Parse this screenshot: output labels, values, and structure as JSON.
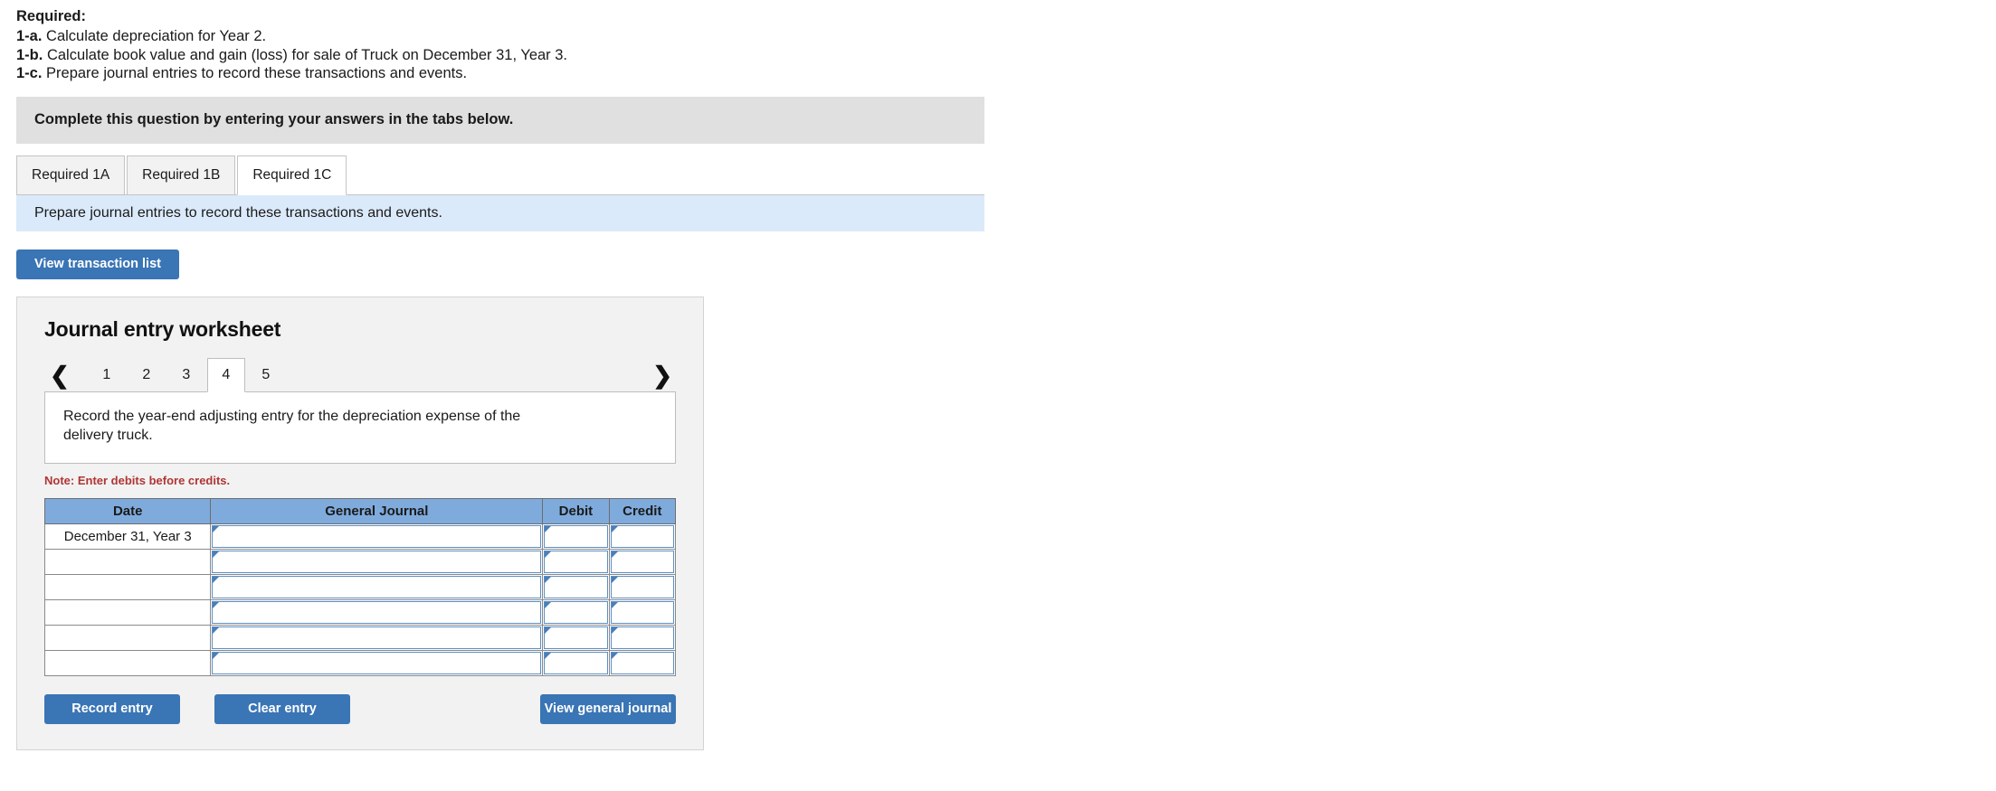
{
  "required": {
    "heading": "Required:",
    "items": [
      {
        "label": "1-a.",
        "text": "Calculate depreciation for Year 2."
      },
      {
        "label": "1-b.",
        "text": "Calculate book value and gain (loss) for sale of Truck on December 31, Year 3."
      },
      {
        "label": "1-c.",
        "text": "Prepare journal entries to record these transactions and events."
      }
    ]
  },
  "gray_banner": {
    "text": "Complete this question by entering your answers in the tabs below."
  },
  "tabs": [
    {
      "label": "Required 1A",
      "active": false
    },
    {
      "label": "Required 1B",
      "active": false
    },
    {
      "label": "Required 1C",
      "active": true
    }
  ],
  "blue_banner": {
    "text": "Prepare journal entries to record these transactions and events."
  },
  "buttons": {
    "view_transaction_list": "View transaction list",
    "record_entry": "Record entry",
    "clear_entry": "Clear entry",
    "view_general_journal": "View general journal"
  },
  "worksheet": {
    "title": "Journal entry worksheet",
    "pager": {
      "prev_icon": "chevron-left",
      "next_icon": "chevron-right",
      "pages": [
        "1",
        "2",
        "3",
        "4",
        "5"
      ],
      "active_page": "4"
    },
    "instruction": "Record the year-end adjusting entry for the depreciation expense of the delivery truck.",
    "note": "Note: Enter debits before credits.",
    "table": {
      "columns": [
        "Date",
        "General Journal",
        "Debit",
        "Credit"
      ],
      "rows": [
        {
          "date": "December 31, Year 3",
          "general_journal": "",
          "debit": "",
          "credit": ""
        },
        {
          "date": "",
          "general_journal": "",
          "debit": "",
          "credit": ""
        },
        {
          "date": "",
          "general_journal": "",
          "debit": "",
          "credit": ""
        },
        {
          "date": "",
          "general_journal": "",
          "debit": "",
          "credit": ""
        },
        {
          "date": "",
          "general_journal": "",
          "debit": "",
          "credit": ""
        },
        {
          "date": "",
          "general_journal": "",
          "debit": "",
          "credit": ""
        }
      ]
    }
  },
  "colors": {
    "accent_blue": "#3a75b5",
    "table_header_blue": "#7fabdc",
    "banner_gray": "#e0e0e0",
    "banner_blue": "#dbeafa",
    "note_red": "#b03535"
  }
}
